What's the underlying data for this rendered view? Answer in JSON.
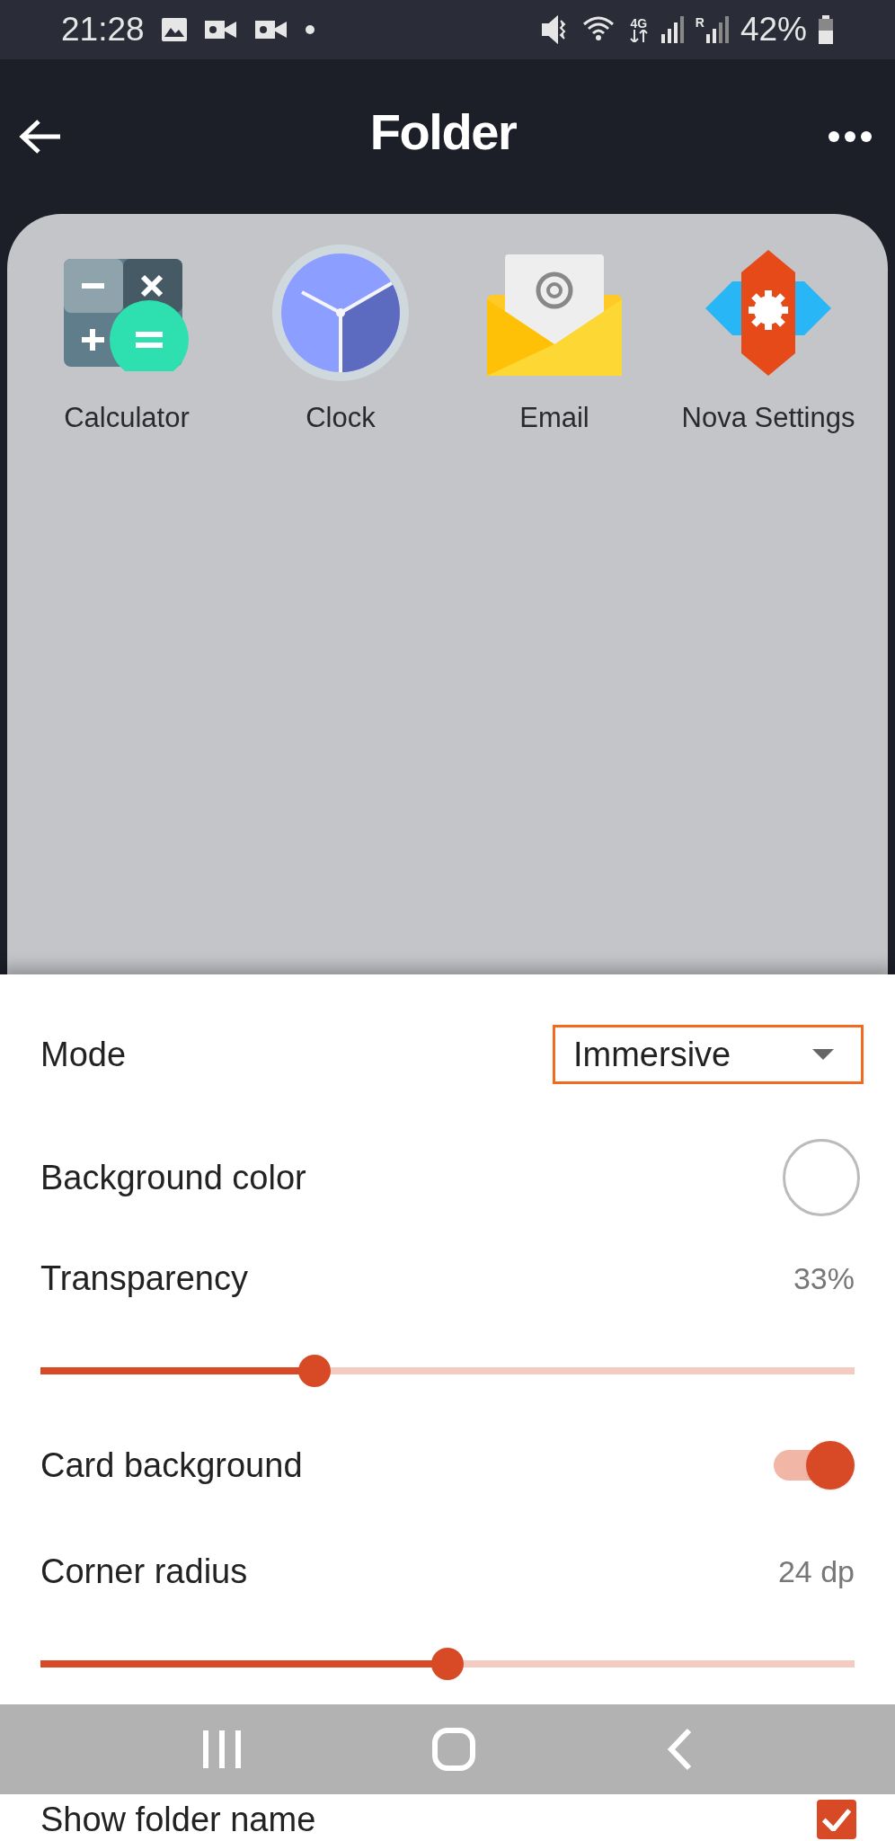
{
  "status_bar": {
    "time": "21:28",
    "battery": "42%",
    "network": "4G",
    "roaming": "R"
  },
  "app_bar": {
    "title": "Folder"
  },
  "folder_apps": [
    {
      "label": "Calculator",
      "kind": "calculator"
    },
    {
      "label": "Clock",
      "kind": "clock"
    },
    {
      "label": "Email",
      "kind": "email"
    },
    {
      "label": "Nova Settings",
      "kind": "settings"
    }
  ],
  "settings": [
    {
      "kind": "dropdown",
      "label": "Mode",
      "value": "Immersive"
    },
    {
      "kind": "color",
      "label": "Background color"
    },
    {
      "kind": "slider",
      "label": "Transparency",
      "reading": "33%",
      "level": 0.33
    },
    {
      "kind": "switch",
      "label": "Card background",
      "on": true
    },
    {
      "kind": "slider",
      "label": "Corner radius",
      "reading": "24 dp",
      "level": 0.5
    },
    {
      "kind": "checkbox",
      "label": "Show folder name",
      "checked": true
    }
  ]
}
